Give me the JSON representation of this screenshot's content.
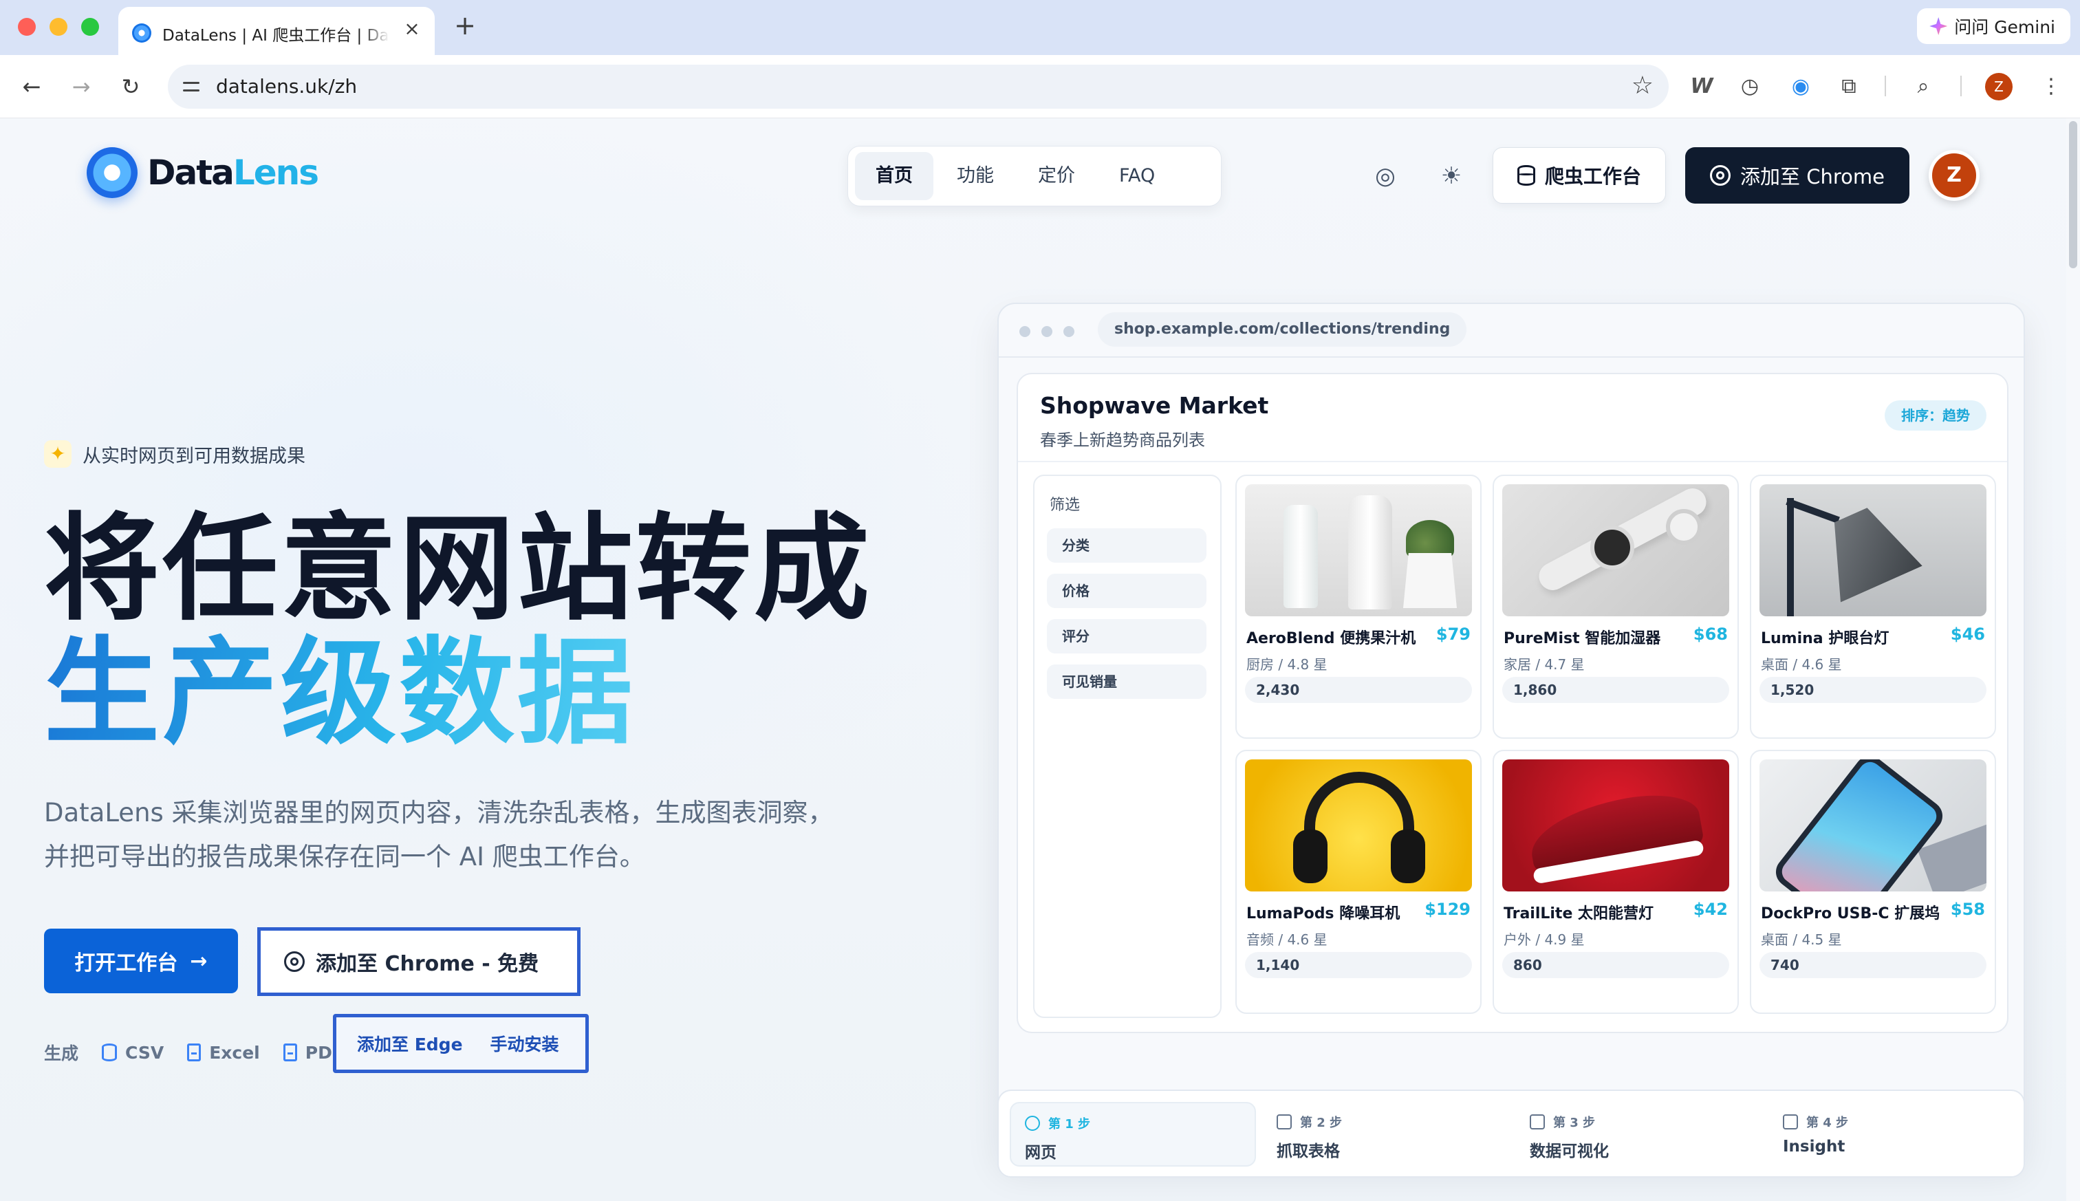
{
  "browser": {
    "tab_title": "DataLens | AI 爬虫工作台 | DataLens",
    "gemini_label": "问问 Gemini",
    "url": "datalens.uk/zh",
    "profile_initial": "Z"
  },
  "site": {
    "logo_data": "Data",
    "logo_lens": "Lens",
    "nav": [
      {
        "label": "首页",
        "active": true
      },
      {
        "label": "功能"
      },
      {
        "label": "定价"
      },
      {
        "label": "FAQ"
      }
    ],
    "workbench_button": "爬虫工作台",
    "add_chrome_button": "添加至 Chrome",
    "avatar_initial": "Z"
  },
  "hero": {
    "badge": "从实时网页到可用数据成果",
    "title_line1": "将任意网站转成",
    "title_line2": "生产级数据",
    "description": "DataLens 采集浏览器里的网页内容，清洗杂乱表格，生成图表洞察，并把可导出的报告成果保存在同一个 AI 爬虫工作台。",
    "open_button": "打开工作台",
    "chrome_free_button": "添加至 Chrome - 免费",
    "edge_button": "添加至 Edge",
    "manual_install": "手动安装",
    "generate_label": "生成",
    "formats": [
      "CSV",
      "Excel",
      "PDF"
    ]
  },
  "preview": {
    "url": "shop.example.com/collections/trending",
    "shop_name": "Shopwave Market",
    "shop_subtitle": "春季上新趋势商品列表",
    "sort_label": "排序：趋势",
    "filter_title": "筛选",
    "filters": [
      "分类",
      "价格",
      "评分",
      "可见销量"
    ],
    "products": [
      {
        "name": "AeroBlend 便携果汁机",
        "price": "$79",
        "meta": "厨房 / 4.8 星",
        "sales": "2,430",
        "image": "blender-image"
      },
      {
        "name": "PureMist 智能加湿器",
        "price": "$68",
        "meta": "家居 / 4.7 星",
        "sales": "1,860",
        "image": "watch-image"
      },
      {
        "name": "Lumina 护眼台灯",
        "price": "$46",
        "meta": "桌面 / 4.6 星",
        "sales": "1,520",
        "image": "lamp-image"
      },
      {
        "name": "LumaPods 降噪耳机",
        "price": "$129",
        "meta": "音频 / 4.6 星",
        "sales": "1,140",
        "image": "headphones-image"
      },
      {
        "name": "TrailLite 太阳能营灯",
        "price": "$42",
        "meta": "户外 / 4.9 星",
        "sales": "860",
        "image": "shoe-image"
      },
      {
        "name": "DockPro USB-C 扩展坞",
        "price": "$58",
        "meta": "桌面 / 4.5 星",
        "sales": "740",
        "image": "phone-image"
      }
    ]
  },
  "steps": [
    {
      "step": "第 1 步",
      "label": "网页",
      "active": true
    },
    {
      "step": "第 2 步",
      "label": "抓取表格"
    },
    {
      "step": "第 3 步",
      "label": "数据可视化"
    },
    {
      "step": "第 4 步",
      "label": "Insight"
    }
  ],
  "colors": {
    "accent": "#0b63d8",
    "lens_cyan": "#22b2e8",
    "dark_button": "#0f1b2e",
    "price": "#1fb5e0",
    "avatar": "#c2410c"
  }
}
